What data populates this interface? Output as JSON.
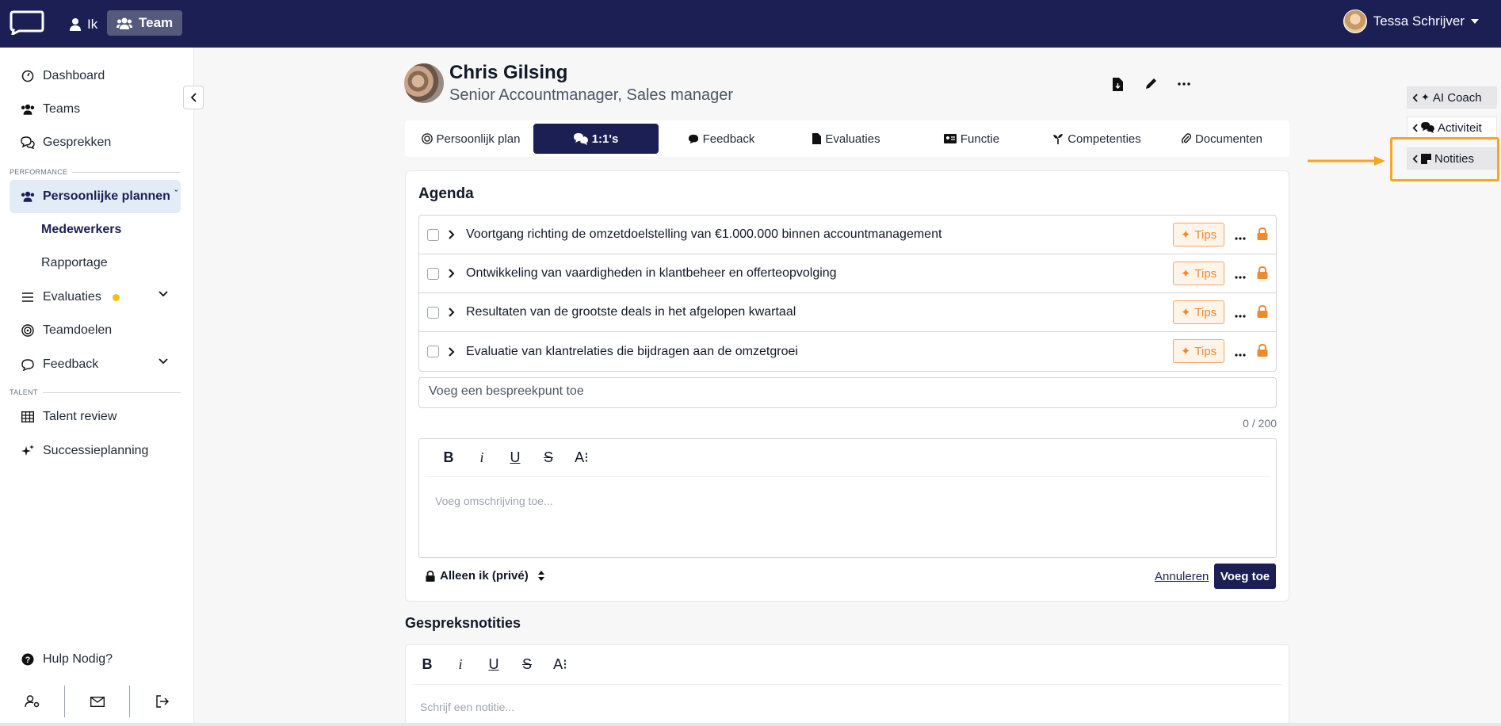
{
  "topbar": {
    "nav": [
      {
        "label": "Ik",
        "icon": "person-icon"
      },
      {
        "label": "Team",
        "icon": "users-icon",
        "active": true
      }
    ],
    "user_name": "Tessa Schrijver"
  },
  "sidebar": {
    "items": [
      {
        "label": "Dashboard",
        "icon": "gauge-icon"
      },
      {
        "label": "Teams",
        "icon": "users-icon"
      },
      {
        "label": "Gesprekken",
        "icon": "chat-icon"
      }
    ],
    "section_performance": "PERFORMANCE",
    "performance_items": [
      {
        "label": "Persoonlijke plannen",
        "icon": "users-icon",
        "active": true
      },
      {
        "label": "Medewerkers",
        "sub": true,
        "bold": true
      },
      {
        "label": "Rapportage",
        "sub": true
      },
      {
        "label": "Evaluaties",
        "icon": "list-icon",
        "badge": true
      },
      {
        "label": "Teamdoelen",
        "icon": "target-icon"
      },
      {
        "label": "Feedback",
        "icon": "comment-icon"
      }
    ],
    "section_talent": "TALENT",
    "talent_items": [
      {
        "label": "Talent review",
        "icon": "grid-icon"
      },
      {
        "label": "Successieplanning",
        "icon": "sparkle-icon"
      }
    ],
    "help": "Hulp Nodig?"
  },
  "profile": {
    "name": "Chris Gilsing",
    "role": "Senior Accountmanager, Sales manager"
  },
  "tabs": [
    {
      "label": "Persoonlijk plan",
      "icon": "target-icon"
    },
    {
      "label": "1:1's",
      "icon": "chats-icon",
      "active": true
    },
    {
      "label": "Feedback",
      "icon": "comment-icon"
    },
    {
      "label": "Evaluaties",
      "icon": "file-icon"
    },
    {
      "label": "Functie",
      "icon": "id-card-icon"
    },
    {
      "label": "Competenties",
      "icon": "seedling-icon"
    },
    {
      "label": "Documenten",
      "icon": "paperclip-icon"
    }
  ],
  "agenda": {
    "title": "Agenda",
    "items": [
      "Voortgang richting de omzetdoelstelling van €1.000.000 binnen accountmanagement",
      "Ontwikkeling van vaardigheden in klantbeheer en offerteopvolging",
      "Resultaten van de grootste deals in het afgelopen kwartaal",
      "Evaluatie van klantrelaties die bijdragen aan de omzetgroei"
    ],
    "tips_label": "Tips",
    "add_placeholder": "Voeg een bespreekpunt toe",
    "counter": "0 / 200",
    "description_placeholder": "Voeg omschrijving toe...",
    "privacy_label": "Alleen ik (privé)",
    "cancel_label": "Annuleren",
    "submit_label": "Voeg toe"
  },
  "notes": {
    "title": "Gespreksnotities",
    "placeholder": "Schrijf een notitie..."
  },
  "right_panel": {
    "ai_coach": "AI Coach",
    "activity": "Activiteit",
    "notes": "Notities"
  },
  "colors": {
    "primary": "#1c1f54",
    "accent_orange": "#f08a2c",
    "highlight": "#f5a623"
  }
}
